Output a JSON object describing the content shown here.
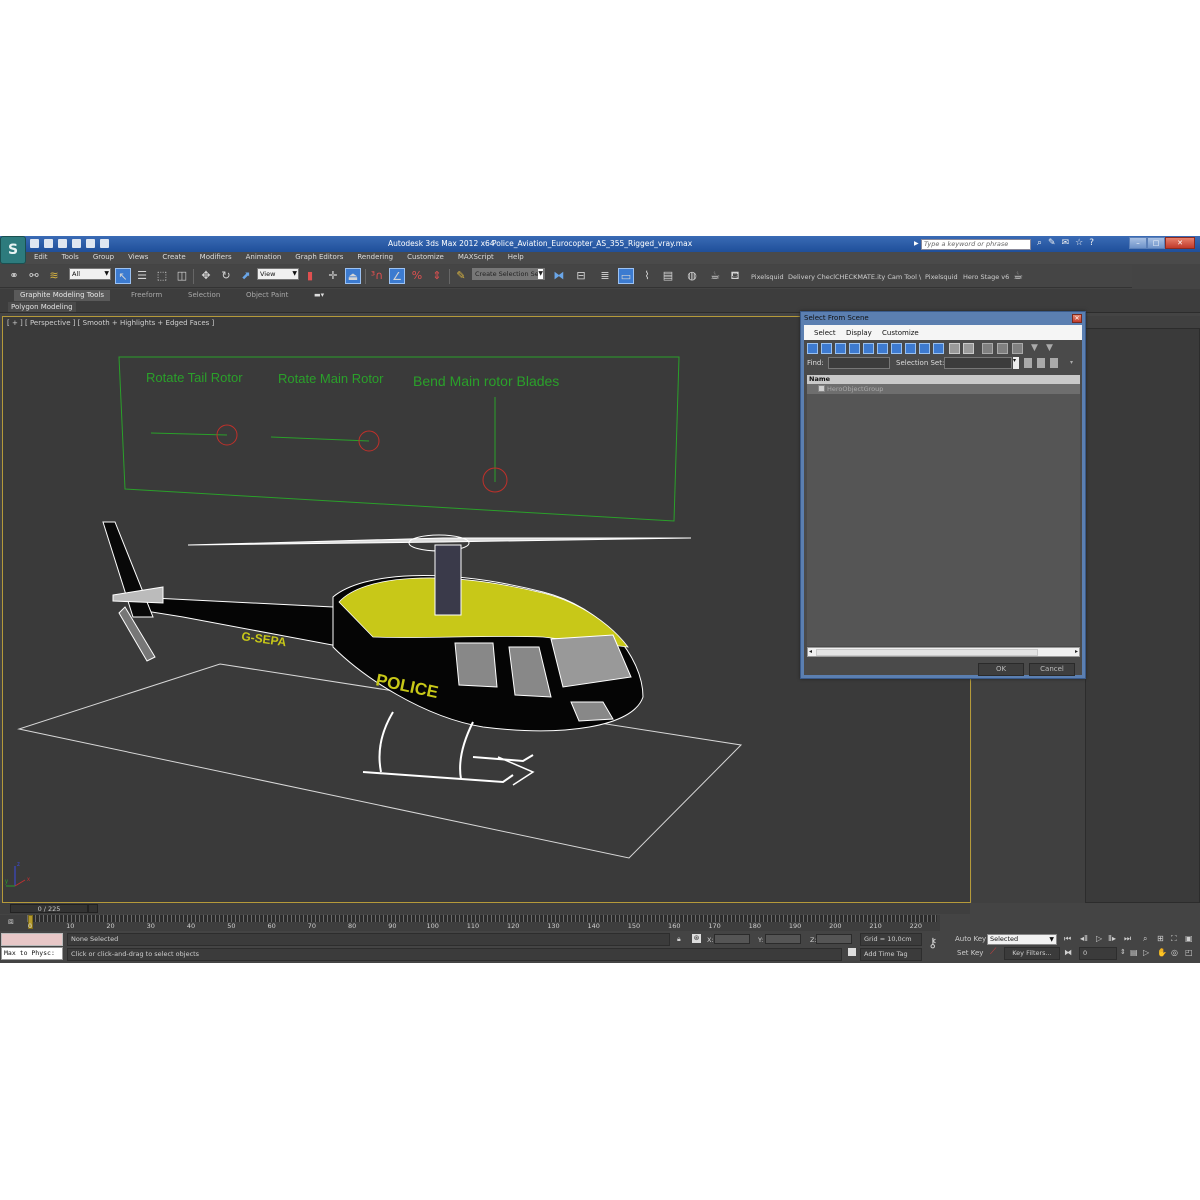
{
  "window": {
    "app_title": "Autodesk 3ds Max  2012 x64",
    "file_name": "Police_Aviation_Eurocopter_AS_355_Rigged_vray.max",
    "search_placeholder": "Type a keyword or phrase",
    "logo": "S"
  },
  "menu": [
    "Edit",
    "Tools",
    "Group",
    "Views",
    "Create",
    "Modifiers",
    "Animation",
    "Graph Editors",
    "Rendering",
    "Customize",
    "MAXScript",
    "Help"
  ],
  "toolbar": {
    "selection_filter": "All",
    "reference_coord": "View",
    "named_selection": "Create Selection Se",
    "scripts": [
      "Pixelsquid",
      "Delivery Checl",
      "CHECKMATE",
      ".ity Cam Tool \\",
      "Pixelsquid",
      "Hero Stage v6"
    ]
  },
  "ribbon": {
    "tabs": [
      "Graphite Modeling Tools",
      "Freeform",
      "Selection",
      "Object Paint"
    ],
    "active_tab": "Graphite Modeling Tools",
    "panel": "Polygon Modeling"
  },
  "viewport": {
    "label": "[ + ] [ Perspective ] [ Smooth + Highlights + Edged Faces ]",
    "rig_labels": [
      "Rotate Tail Rotor",
      "Rotate Main Rotor",
      "Bend Main rotor Blades"
    ],
    "registration": "G-SEPA",
    "livery_text": "POLICE",
    "axis_labels": [
      "x",
      "y",
      "z"
    ],
    "colors": {
      "rig": "#2aa02a",
      "fuselage_top": "#c8c818",
      "fuselage": "#050505",
      "wire": "#ffffff",
      "border": "#b59a3a"
    }
  },
  "dialog": {
    "title": "Select From Scene",
    "menu": [
      "Select",
      "Display",
      "Customize"
    ],
    "find_label": "Find:",
    "find_value": "",
    "selection_set_label": "Selection Set:",
    "selection_set_value": "",
    "column_header": "Name",
    "items": [
      "HeroObjectGroup"
    ],
    "ok": "OK",
    "cancel": "Cancel"
  },
  "timeline": {
    "frame_display": "0 / 225",
    "current_frame": 0,
    "total_frames": 225,
    "ticks": [
      0,
      10,
      20,
      30,
      40,
      50,
      60,
      70,
      80,
      90,
      100,
      110,
      120,
      130,
      140,
      150,
      160,
      170,
      180,
      190,
      200,
      210,
      220
    ]
  },
  "status": {
    "script_listener": "Max to Physc:",
    "selection": "None Selected",
    "prompt": "Click or click-and-drag to select objects",
    "x_label": "X:",
    "y_label": "Y:",
    "z_label": "Z:",
    "x": "",
    "y": "",
    "z": "",
    "grid": "Grid = 10,0cm",
    "add_time_tag": "Add Time Tag",
    "auto_key": "Auto Key",
    "set_key": "Set Key",
    "key_mode": "Selected",
    "key_filters": "Key Filters...",
    "frame_field": "0"
  }
}
